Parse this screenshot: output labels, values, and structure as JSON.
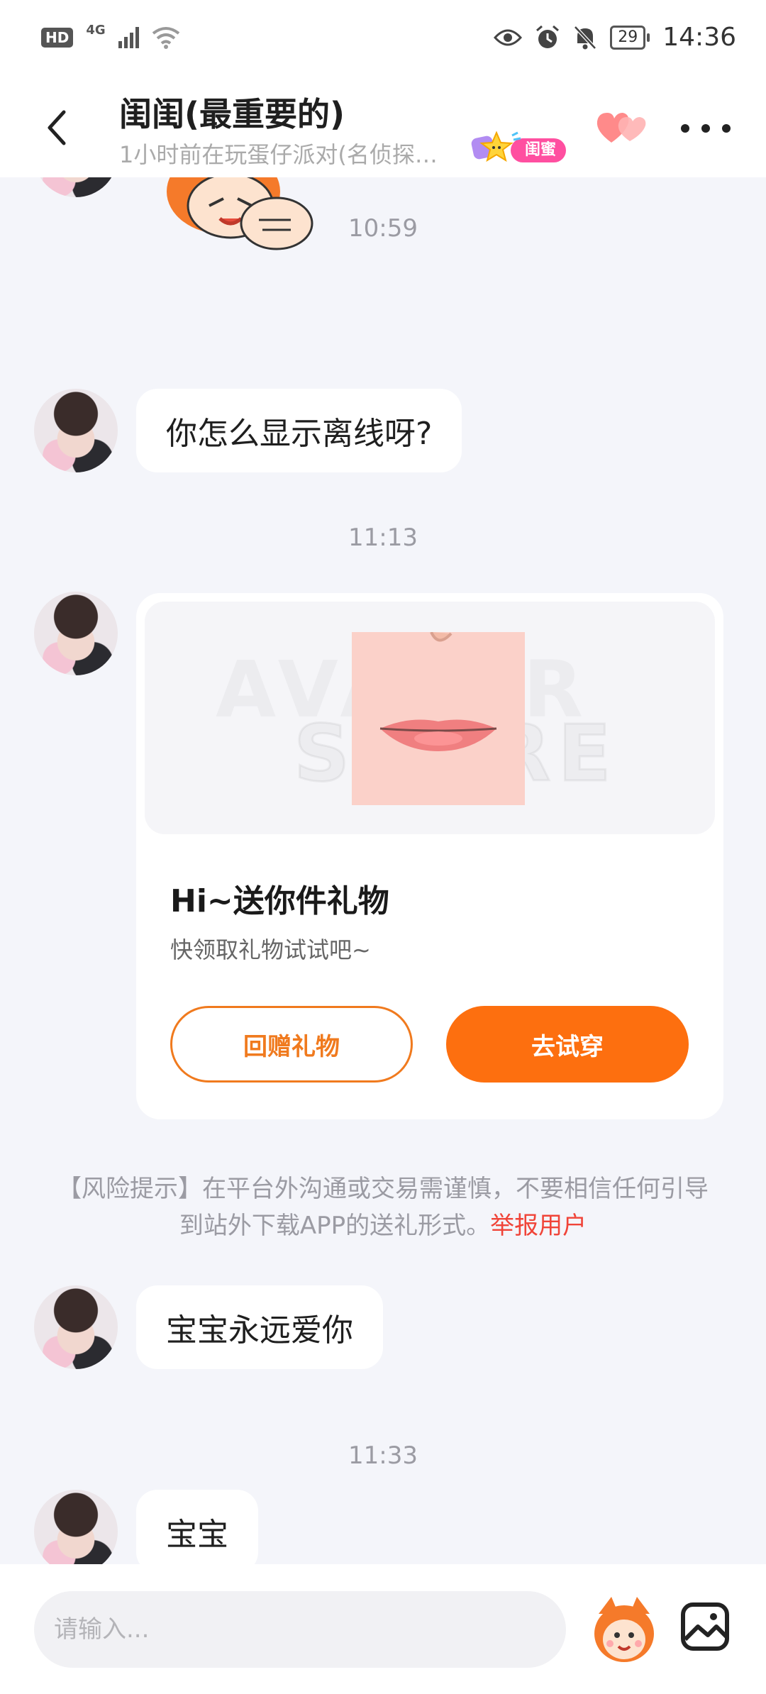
{
  "status_bar": {
    "hd": "HD",
    "network": "4G",
    "battery": "29",
    "time": "14:36"
  },
  "header": {
    "title": "闺闺(最重要的)",
    "subtitle": "1小时前在玩蛋仔派对(名侦探…",
    "relation_tag": "闺蜜"
  },
  "messages": [
    {
      "timestamp": "10:59",
      "text": "你怎么显示离线呀?"
    },
    {
      "timestamp": "11:13"
    },
    {
      "text": "宝宝永远爱你"
    },
    {
      "timestamp": "11:33",
      "text": "宝宝"
    }
  ],
  "gift_card": {
    "watermark_top": "AVATAR",
    "watermark_bottom": "STORE",
    "title": "Hi~送你件礼物",
    "description": "快领取礼物试试吧~",
    "return_gift_label": "回赠礼物",
    "try_on_label": "去试穿"
  },
  "risk_notice": {
    "text": "【风险提示】在平台外沟通或交易需谨慎，不要相信任何引导到站外下载APP的送礼形式。",
    "report_label": "举报用户"
  },
  "input": {
    "placeholder": "请输入..."
  },
  "colors": {
    "accent_orange": "#fd6f0f",
    "report_red": "#f04438",
    "tag_pink": "#ff4fa0",
    "background": "#f4f5fa"
  }
}
